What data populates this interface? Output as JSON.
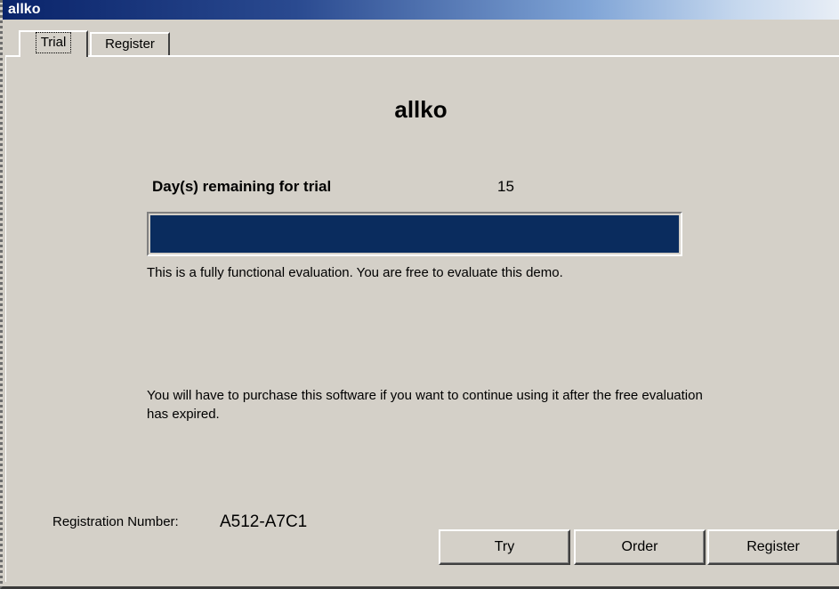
{
  "window": {
    "title": "allko"
  },
  "tabs": [
    {
      "label": "Trial",
      "active": true
    },
    {
      "label": "Register",
      "active": false
    }
  ],
  "main": {
    "app_title": "allko",
    "days_label": "Day(s) remaining for trial",
    "days_value": "15",
    "trial_progress_fraction": 1.0,
    "progress_color": "#0a2c5e",
    "eval_text": "This is a fully functional evaluation. You are free to evaluate this demo.",
    "purchase_text": "You will have to purchase this software if you want to continue using it after the free evaluation has expired.",
    "registration_label": "Registration Number:",
    "registration_number": "A512-A7C1"
  },
  "buttons": {
    "try_label": "Try",
    "order_label": "Order",
    "register_label": "Register"
  },
  "colors": {
    "titlebar_start": "#0a246a",
    "dialog_background": "#d4d0c8"
  }
}
